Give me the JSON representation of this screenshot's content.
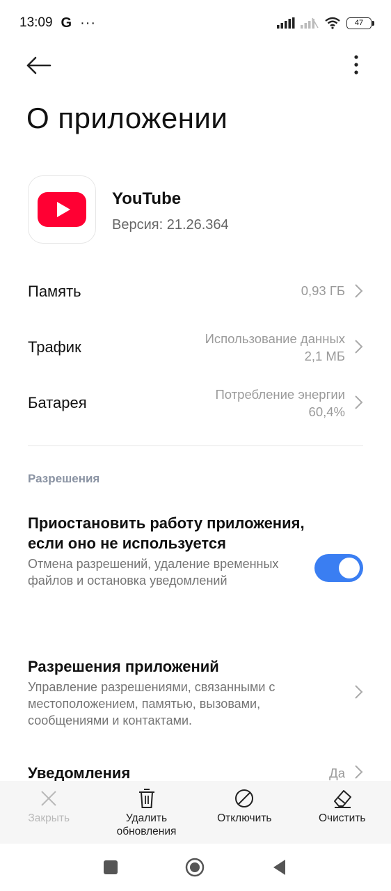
{
  "status_bar": {
    "time": "13:09",
    "google_badge": "G",
    "more_notifications": "···",
    "battery_level": "47"
  },
  "page": {
    "title": "О приложении"
  },
  "app": {
    "name": "YouTube",
    "version": "Версия: 21.26.364",
    "icon": "youtube-logo",
    "brand_color": "#ff0033"
  },
  "info_rows": [
    {
      "label": "Память",
      "value_line1": "0,93 ГБ",
      "value_line2": ""
    },
    {
      "label": "Трафик",
      "value_line1": "Использование данных",
      "value_line2": "2,1 МБ"
    },
    {
      "label": "Батарея",
      "value_line1": "Потребление энергии",
      "value_line2": "60,4%"
    }
  ],
  "permissions": {
    "section_title": "Разрешения",
    "pause_title": "Приостановить работу приложения, если оно не используется",
    "pause_desc": "Отмена разрешений, удаление временных файлов и остановка уведомлений",
    "pause_enabled": true,
    "app_perms_title": "Разрешения приложений",
    "app_perms_desc": "Управление разрешениями, связанными с местоположением, памятью, вызовами, сообщениями и контактами.",
    "notifications_title": "Уведомления",
    "notifications_value": "Да"
  },
  "bottom_actions": [
    {
      "label": "Закрыть",
      "icon": "close-icon",
      "enabled": false
    },
    {
      "label": "Удалить обновления",
      "icon": "trash-icon",
      "enabled": true
    },
    {
      "label": "Отключить",
      "icon": "disable-icon",
      "enabled": true
    },
    {
      "label": "Очистить",
      "icon": "eraser-icon",
      "enabled": true
    }
  ],
  "colors": {
    "accent": "#3a7ef2",
    "section_title": "#8a93a3",
    "secondary_text": "#9a9a9a"
  }
}
